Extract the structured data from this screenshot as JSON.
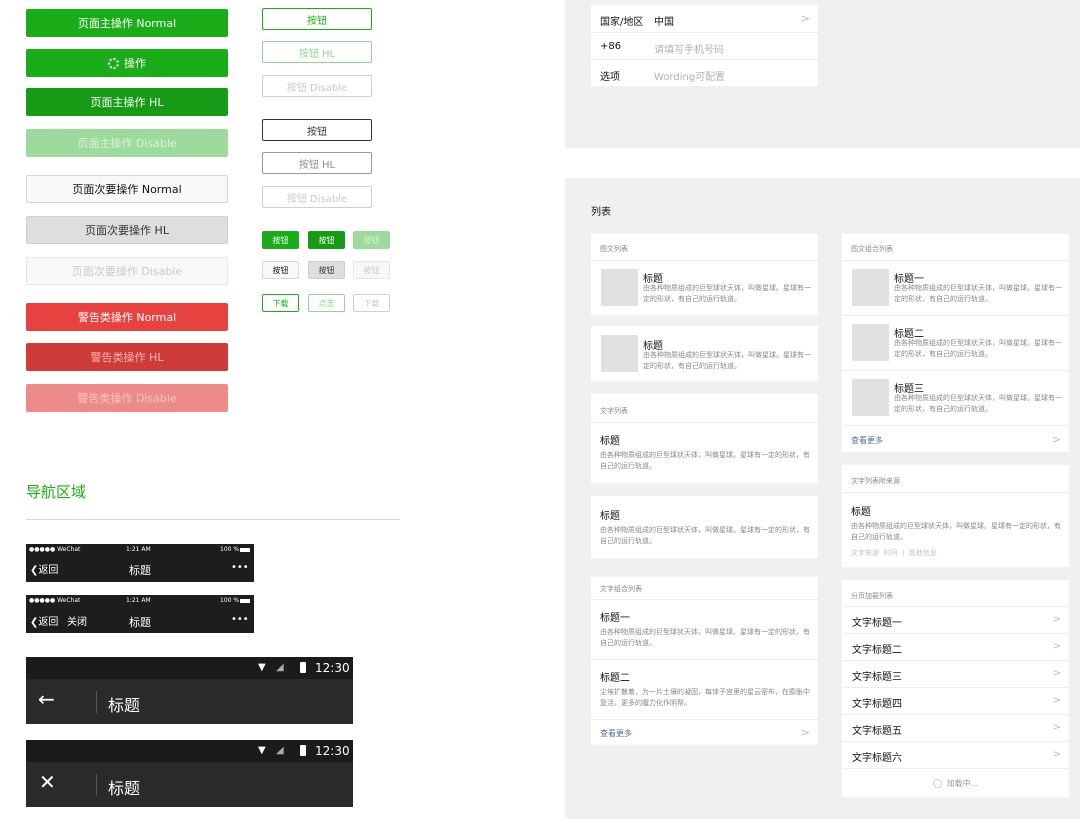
{
  "buttons": {
    "primary_normal": "页面主操作 Normal",
    "primary_loading": "操作",
    "primary_hl": "页面主操作 HL",
    "primary_disable": "页面主操作 Disable",
    "secondary_normal": "页面次要操作 Normal",
    "secondary_hl": "页面次要操作 HL",
    "secondary_disable": "页面次要操作 Disable",
    "warn_normal": "警告类操作 Normal",
    "warn_hl": "警告类操作 HL",
    "warn_disable": "警告类操作 Disable"
  },
  "plain_buttons": {
    "green": "按钮",
    "green_hl": "按钮 HL",
    "green_disable": "按钮 Disable",
    "black": "按钮",
    "black_hl": "按钮 HL",
    "black_disable": "按钮 Disable"
  },
  "mini_buttons": {
    "row1": [
      "按钮",
      "按钮",
      "按钮"
    ],
    "row2": [
      "按钮",
      "按钮",
      "按钮"
    ],
    "row3": [
      "下载",
      "点击",
      "下载"
    ]
  },
  "nav_section_title": "导航区域",
  "ios_nav_1": {
    "carrier": "●●●●● WeChat",
    "time": "1:21 AM",
    "battery": "100 %",
    "back": "返回",
    "title": "标题",
    "more": "•••"
  },
  "ios_nav_2": {
    "carrier": "●●●●● WeChat",
    "time": "1:21 AM",
    "battery": "100 %",
    "back": "返回",
    "close": "关闭",
    "title": "标题",
    "more": "•••"
  },
  "android_nav_1": {
    "time": "12:30",
    "title": "标题",
    "nav_icon": "arrow-left",
    "menu": "⋮"
  },
  "android_nav_2": {
    "time": "12:30",
    "title": "标题",
    "nav_icon": "close",
    "menu": "⋮"
  },
  "form": {
    "rows": [
      {
        "label": "国家/地区",
        "value": "中国",
        "placeholder": ""
      },
      {
        "label": "+86",
        "value": "",
        "placeholder": "请填写手机号码"
      },
      {
        "label": "选项",
        "value": "",
        "placeholder": "Wording可配置"
      }
    ]
  },
  "lists": {
    "title": "列表",
    "media_list": {
      "caption": "图文列表",
      "items": [
        {
          "title": "标题",
          "desc": "由各种物质组成的巨型球状天体，叫做星球。星球有一定的形状，有自己的运行轨道。"
        },
        {
          "title": "标题",
          "desc": "由各种物质组成的巨型球状天体，叫做星球。星球有一定的形状，有自己的运行轨道。"
        }
      ]
    },
    "text_list": {
      "caption": "文字列表",
      "items": [
        {
          "title": "标题",
          "desc": "由各种物质组成的巨型球状天体，叫做星球。星球有一定的形状，有自己的运行轨道。"
        },
        {
          "title": "标题",
          "desc": "由各种物质组成的巨型球状天体，叫做星球。星球有一定的形状，有自己的运行轨道。"
        }
      ]
    },
    "text_group": {
      "caption": "文字组合列表",
      "items": [
        {
          "title": "标题一",
          "desc": "由各种物质组成的巨型球状天体，叫做星球。星球有一定的形状，有自己的运行轨道。"
        },
        {
          "title": "标题二",
          "desc": "尘埃扩散着，为一片土壤的凝固，每体子宫里的星云密布，在膨胀中复活，更多的魔力化作阴帮。"
        }
      ],
      "more": "查看更多"
    },
    "media_group": {
      "caption": "图文组合列表",
      "items": [
        {
          "title": "标题一",
          "desc": "由各种物质组成的巨型球状天体，叫做星球。星球有一定的形状，有自己的运行轨道。"
        },
        {
          "title": "标题二",
          "desc": "由各种物质组成的巨型球状天体，叫做星球。星球有一定的形状，有自己的运行轨道。"
        },
        {
          "title": "标题三",
          "desc": "由各种物质组成的巨型球状天体，叫做星球。星球有一定的形状，有自己的运行轨道。"
        }
      ],
      "more": "查看更多"
    },
    "source_list": {
      "caption": "文字列表附来源",
      "title": "标题",
      "desc": "由各种物质组成的巨型球状天体，叫做星球。星球有一定的形状，有自己的运行轨道。",
      "meta": "文字来源  时间  |  其他信息"
    },
    "paged_list": {
      "caption": "分页加载列表",
      "items": [
        "文字标题一",
        "文字标题二",
        "文字标题三",
        "文字标题四",
        "文字标题五",
        "文字标题六"
      ],
      "loading": "加载中..."
    }
  },
  "chevron": ">",
  "colors": {
    "primary": "#1aad19",
    "warn": "#e64340",
    "link": "#576b95"
  }
}
